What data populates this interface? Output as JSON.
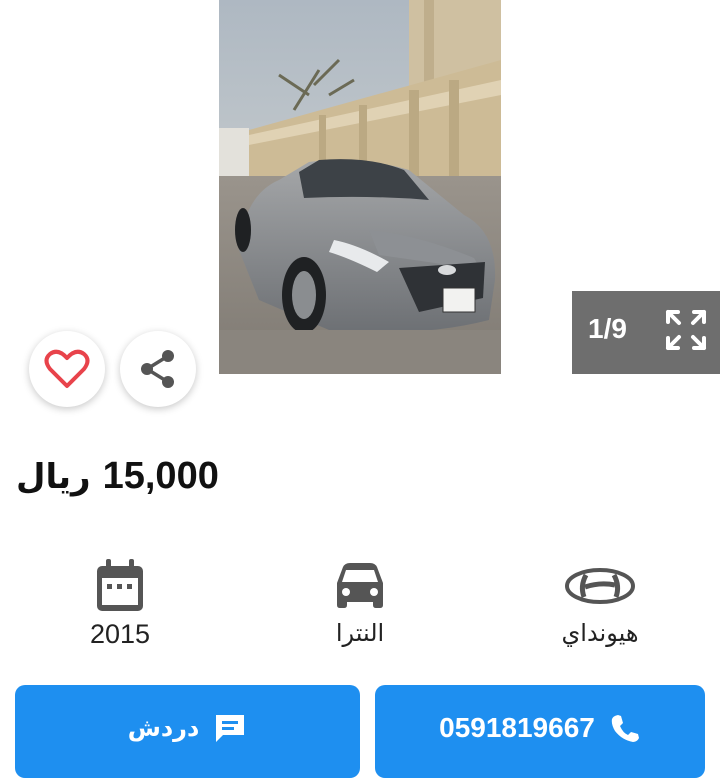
{
  "gallery": {
    "counter": "1/9",
    "prev_icon": "chevron-left-icon",
    "next_icon": "chevron-right-icon",
    "expand_icon": "expand-icon"
  },
  "actions": {
    "favorite_icon": "heart-icon",
    "share_icon": "share-icon"
  },
  "listing": {
    "price": "15,000",
    "currency": "ريال"
  },
  "specs": {
    "year": "2015",
    "model": "النترا",
    "make": "هيونداي"
  },
  "buttons": {
    "chat_label": "دردش",
    "call_label": "0591819667"
  },
  "colors": {
    "primary": "#1e8ff0",
    "favorite": "#e8434b",
    "counter_bg": "#6e6e6e"
  }
}
